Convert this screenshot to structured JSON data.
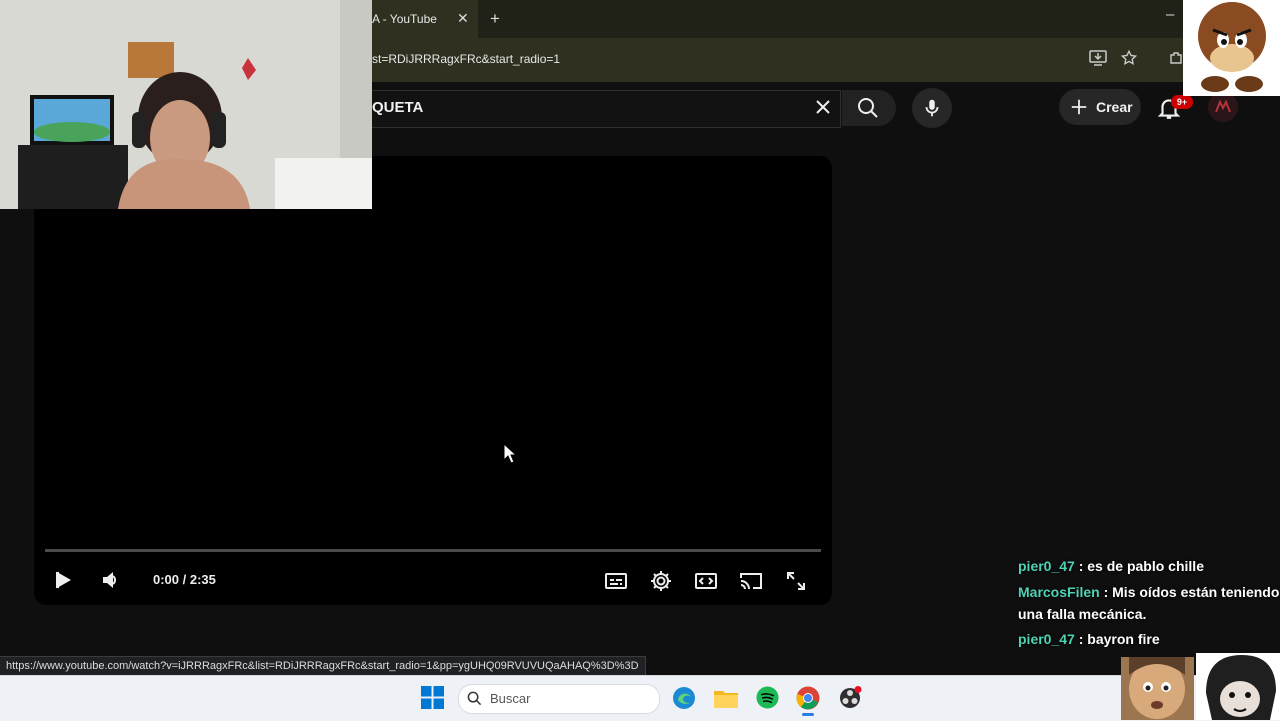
{
  "browser": {
    "tab_title": "A - YouTube",
    "tab_close": "✕",
    "new_tab": "+",
    "minimize": "–",
    "url": "st=RDiJRRRagxFRc&start_radio=1"
  },
  "youtube": {
    "search_value": "QUETA",
    "create_label": "Crear",
    "notification_badge": "9+"
  },
  "player": {
    "time_display": "0:00 / 2:35",
    "progress_fraction": 0
  },
  "status_url": "https://www.youtube.com/watch?v=iJRRRagxFRc&list=RDiJRRRagxFRc&start_radio=1&pp=ygUHQ09RVUVUQaAHAQ%3D%3D",
  "chat": {
    "messages": [
      {
        "user": "pier0_47",
        "text": ": es de pablo chille"
      },
      {
        "user": "MarcosFilen",
        "text": ": Mis oídos están teniendo una falla mecánica."
      },
      {
        "user": "pier0_47",
        "text": ": bayron fire"
      }
    ]
  },
  "taskbar": {
    "search_label": "Buscar",
    "apps": [
      "windows-start-icon",
      "edge-icon",
      "file-explorer-icon",
      "spotify-icon",
      "chrome-icon",
      "obs-icon"
    ]
  },
  "colors": {
    "accent_red": "#ff0000",
    "chat_username": "#4fd1b5",
    "page_bg": "#0f0f0f"
  }
}
